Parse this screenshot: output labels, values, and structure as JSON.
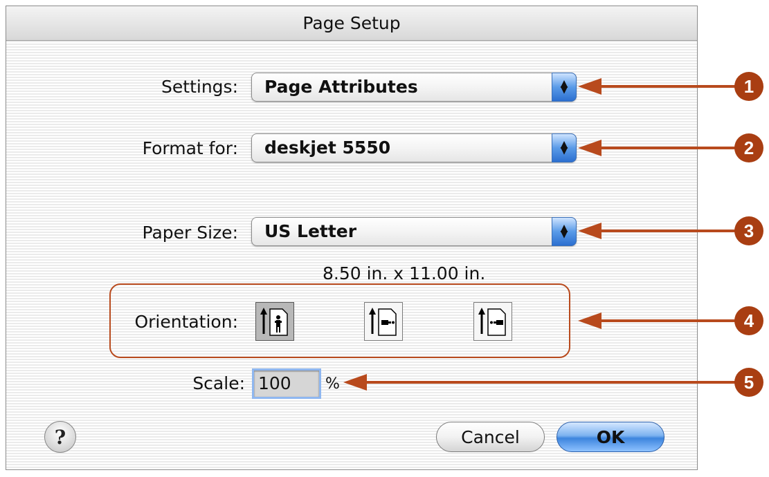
{
  "dialog": {
    "title": "Page Setup",
    "settings": {
      "label": "Settings:",
      "value": "Page Attributes"
    },
    "format_for": {
      "label": "Format for:",
      "value": "deskjet 5550"
    },
    "paper_size": {
      "label": "Paper Size:",
      "value": "US Letter",
      "dimensions": "8.50 in. x 11.00 in."
    },
    "orientation": {
      "label": "Orientation:",
      "options": [
        "portrait",
        "landscape",
        "reverse-landscape"
      ],
      "selected": "portrait"
    },
    "scale": {
      "label": "Scale:",
      "value": "100",
      "unit": "%"
    },
    "help_label": "?",
    "cancel_label": "Cancel",
    "ok_label": "OK"
  },
  "callouts": [
    "1",
    "2",
    "3",
    "4",
    "5"
  ],
  "colors": {
    "callout": "#b84a1d",
    "accent_blue": "#3d85de"
  },
  "icons": {
    "popup": "up-down-arrows-icon",
    "orientation": "page-with-person-icon",
    "help": "question-mark-icon"
  }
}
